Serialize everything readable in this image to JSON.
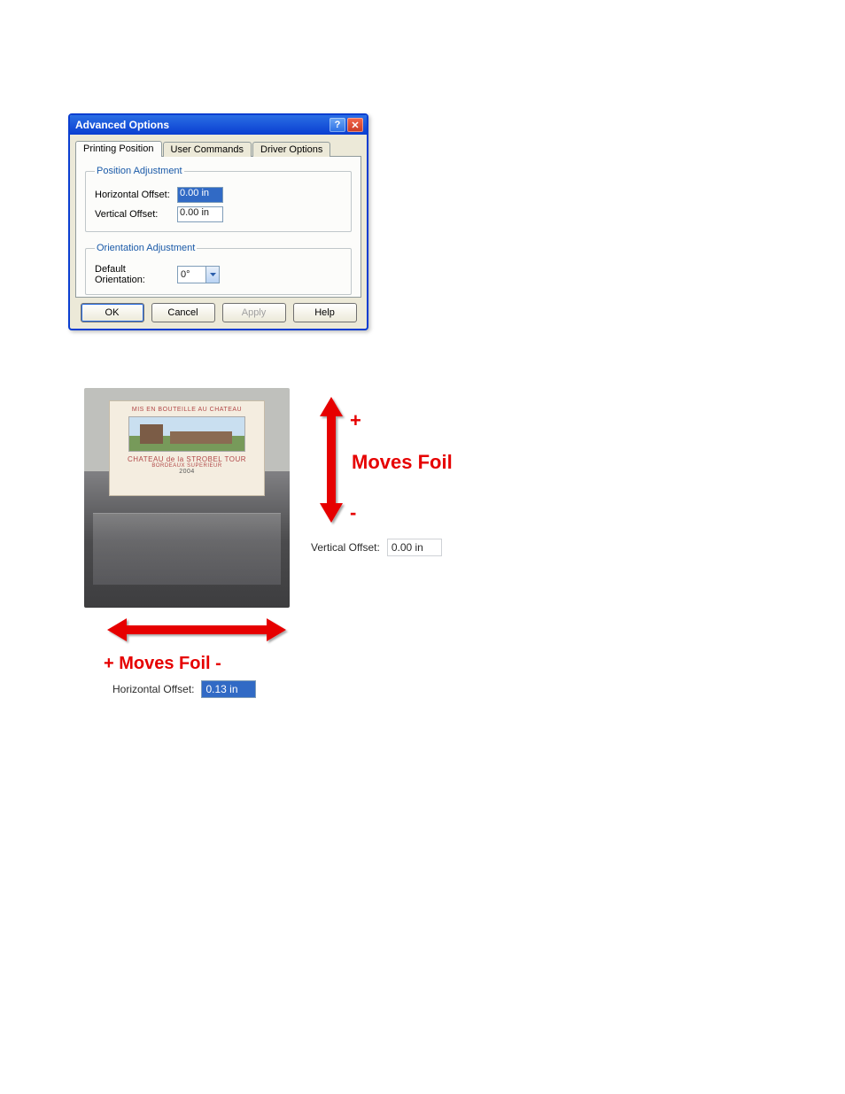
{
  "dialog": {
    "title": "Advanced Options",
    "tabs": [
      "Printing Position",
      "User Commands",
      "Driver Options"
    ],
    "positionGroup": {
      "legend": "Position Adjustment",
      "hLabel": "Horizontal Offset:",
      "hValue": "0.00 in",
      "vLabel": "Vertical Offset:",
      "vValue": "0.00 in"
    },
    "orientationGroup": {
      "legend": "Orientation Adjustment",
      "label": "Default Orientation:",
      "value": "0°"
    },
    "buttons": {
      "ok": "OK",
      "cancel": "Cancel",
      "apply": "Apply",
      "help": "Help"
    }
  },
  "illus": {
    "labelTop": "MIS EN BOUTEILLE AU CHATEAU",
    "labelBrand": "CHATEAU de la STROBEL TOUR",
    "labelAoc": "BORDEAUX SUPERIEUR",
    "labelYear": "2004",
    "vPlus": "+",
    "vMinus": "-",
    "movesFoil": "Moves Foil",
    "hPlusMinus": "+ Moves Foil -",
    "vOffsetLabel": "Vertical Offset:",
    "vOffsetValue": "0.00 in",
    "hOffsetLabel": "Horizontal Offset:",
    "hOffsetValue": "0.13 in"
  }
}
